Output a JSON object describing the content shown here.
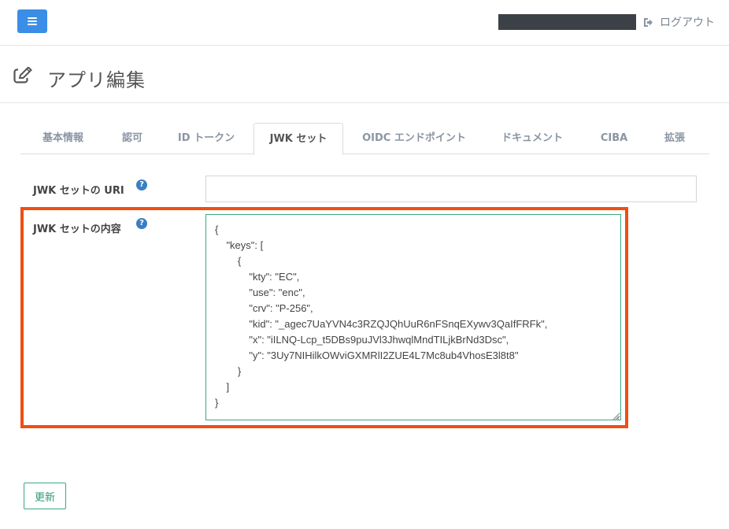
{
  "topbar": {
    "menu_icon": "hamburger-icon",
    "logout_icon": "sign-out-icon",
    "logout_label": "ログアウト"
  },
  "header": {
    "icon": "edit-icon",
    "title": "アプリ編集"
  },
  "tabs": [
    {
      "label": "基本情報",
      "active": false
    },
    {
      "label": "認可",
      "active": false
    },
    {
      "label": "ID トークン",
      "active": false
    },
    {
      "label": "JWK セット",
      "active": true
    },
    {
      "label": "OIDC エンドポイント",
      "active": false
    },
    {
      "label": "ドキュメント",
      "active": false
    },
    {
      "label": "CIBA",
      "active": false
    },
    {
      "label": "拡張",
      "active": false
    }
  ],
  "form": {
    "jwks_uri_label": "JWK セットの URI",
    "jwks_uri_value": "",
    "jwks_content_label": "JWK セットの内容",
    "jwks_content_value": "{\n    \"keys\": [\n        {\n            \"kty\": \"EC\",\n            \"use\": \"enc\",\n            \"crv\": \"P-256\",\n            \"kid\": \"_agec7UaYVN4c3RZQJQhUuR6nFSnqEXywv3QaIfFRFk\",\n            \"x\": \"iILNQ-Lcp_t5DBs9puJVl3JhwqlMndTILjkBrNd3Dsc\",\n            \"y\": \"3Uy7NIHilkOWviGXMRlI2ZUE4L7Mc8ub4VhosE3l8t8\"\n        }\n    ]\n}",
    "help_icon": "question-circle-icon",
    "help_glyph": "?"
  },
  "actions": {
    "update_label": "更新"
  },
  "colors": {
    "accent": "#3a8ee6",
    "highlight": "#f04e12",
    "success": "#3aa884"
  }
}
